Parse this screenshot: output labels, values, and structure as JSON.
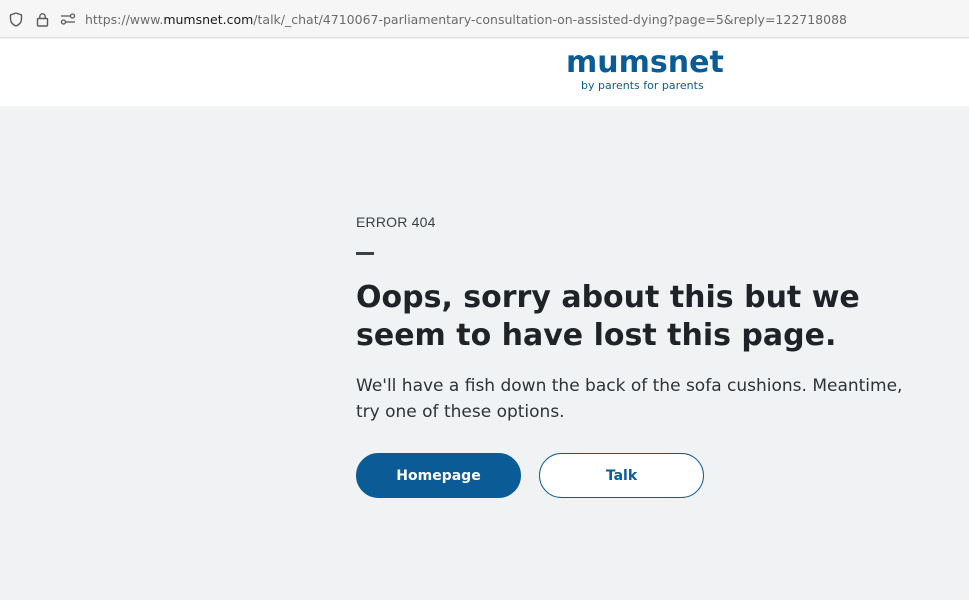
{
  "browser": {
    "url_prefix": "https://www.",
    "url_host": "mumsnet.com",
    "url_path": "/talk/_chat/4710067-parliamentary-consultation-on-assisted-dying?page=5&reply=122718088",
    "icons": [
      "shield-icon",
      "lock-icon",
      "permissions-icon"
    ]
  },
  "header": {
    "logo_text": "mumsnet",
    "logo_tagline": "by parents for parents",
    "brand_color": "#0b5c96"
  },
  "error": {
    "eyebrow": "ERROR 404",
    "headline": "Oops, sorry about this but we seem to have lost this page.",
    "body": "We'll have a fish down the back of the sofa cushions. Meantime, try one of these options."
  },
  "actions": {
    "homepage_label": "Homepage",
    "talk_label": "Talk"
  }
}
